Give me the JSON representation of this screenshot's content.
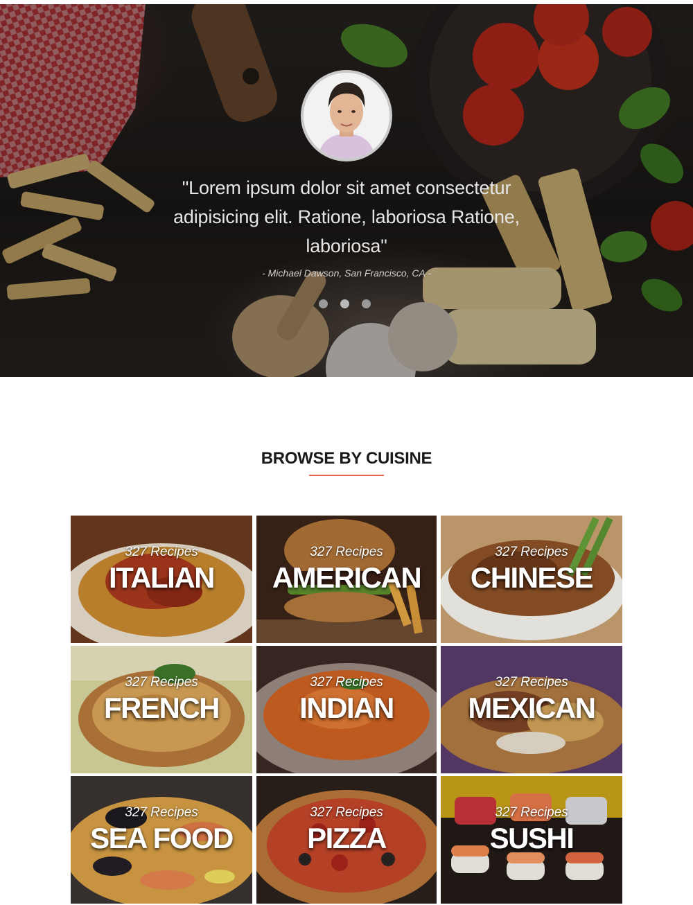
{
  "testimonial": {
    "quote": "\"Lorem ipsum dolor sit amet consectetur adipisicing elit. Ratione, laboriosa Ratione, laboriosa\"",
    "author": "- Michael Dawson, San Francisco, CA -",
    "avatar_icon": "person-avatar-icon",
    "slide_count": 3,
    "active_slide": 2
  },
  "browse": {
    "title": "BROWSE BY CUISINE",
    "accent_color": "#e5604d",
    "cuisines": [
      {
        "name": "ITALIAN",
        "count": "327 Recipes"
      },
      {
        "name": "AMERICAN",
        "count": "327 Recipes"
      },
      {
        "name": "CHINESE",
        "count": "327 Recipes"
      },
      {
        "name": "FRENCH",
        "count": "327 Recipes"
      },
      {
        "name": "INDIAN",
        "count": "327 Recipes"
      },
      {
        "name": "MEXICAN",
        "count": "327 Recipes"
      },
      {
        "name": "SEA FOOD",
        "count": "327 Recipes"
      },
      {
        "name": "PIZZA",
        "count": "327 Recipes"
      },
      {
        "name": "SUSHI",
        "count": "327 Recipes"
      }
    ]
  }
}
